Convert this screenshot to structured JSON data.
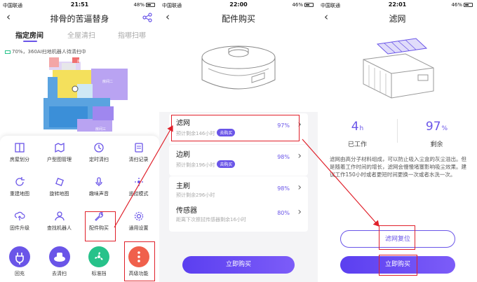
{
  "status_bars": [
    {
      "carrier": "中国联通",
      "time": "21:51",
      "battery": "48%",
      "battery_level": 0.48
    },
    {
      "carrier": "中国联通",
      "time": "22:00",
      "battery": "46%",
      "battery_level": 0.46
    },
    {
      "carrier": "中国联通",
      "time": "22:01",
      "battery": "46%",
      "battery_level": 0.46
    }
  ],
  "screen1": {
    "title": "排骨的苦逼替身",
    "tabs": [
      "指定房间",
      "全屋清扫",
      "指哪扫哪"
    ],
    "map_status": "70%，360AI扫地机器人待清扫中",
    "room_labels": [
      "房间",
      "房间二",
      "房间三"
    ],
    "functions": [
      {
        "label": "房屋划分",
        "icon": "split-room-icon"
      },
      {
        "label": "户型图管理",
        "icon": "map-manage-icon"
      },
      {
        "label": "定时清扫",
        "icon": "clock-icon"
      },
      {
        "label": "清扫记录",
        "icon": "record-icon"
      },
      {
        "label": "重建地图",
        "icon": "rebuild-map-icon"
      },
      {
        "label": "旋转地图",
        "icon": "rotate-map-icon"
      },
      {
        "label": "趣味声音",
        "icon": "microphone-icon"
      },
      {
        "label": "遥控模式",
        "icon": "remote-control-icon"
      },
      {
        "label": "固件升级",
        "icon": "firmware-upload-icon"
      },
      {
        "label": "查找机器人",
        "icon": "find-robot-icon"
      },
      {
        "label": "配件购买",
        "icon": "wrench-icon"
      },
      {
        "label": "通用设置",
        "icon": "gear-icon"
      }
    ],
    "bottom": [
      {
        "label": "回充",
        "icon": "charge-plug-icon",
        "color": "#6a55e8"
      },
      {
        "label": "去清扫",
        "icon": "robot-clean-icon",
        "color": "#6a55e8"
      },
      {
        "label": "标准挡",
        "icon": "fan-icon",
        "color": "#27c28a"
      },
      {
        "label": "高级功能",
        "icon": "more-dots-icon",
        "color": "#f0604c"
      }
    ]
  },
  "screen2": {
    "title": "配件购买",
    "items": [
      {
        "name": "滤网",
        "sub": "预计剩余146小时",
        "pct": "97%",
        "badge": "去购买"
      },
      {
        "name": "边刷",
        "sub": "预计剩余196小时",
        "pct": "98%",
        "badge": "去购买"
      },
      {
        "name": "主刷",
        "sub": "预计剩余296小时",
        "pct": "98%",
        "badge": ""
      },
      {
        "name": "传感器",
        "sub": "距离下次擦拭传感器剩余16小时",
        "pct": "80%",
        "badge": ""
      }
    ],
    "buy_label": "立即购买"
  },
  "screen3": {
    "title": "滤网",
    "worked_value": "4",
    "worked_unit": "h",
    "worked_caption": "已工作",
    "remain_value": "97",
    "remain_unit": "%",
    "remain_caption": "剩余",
    "description": "滤网由高分子材料组成，可以防止吸入尘盒的灰尘溢出。但是随着工作时间的增长，滤网会慢慢堵塞影响吸尘效果。建议工作150小时或者更短时间更换一次或者水洗一次。",
    "reset_label": "滤网复位",
    "buy_label": "立即购买"
  },
  "colors": {
    "accent": "#6a55e8",
    "highlight": "#e0202a"
  }
}
